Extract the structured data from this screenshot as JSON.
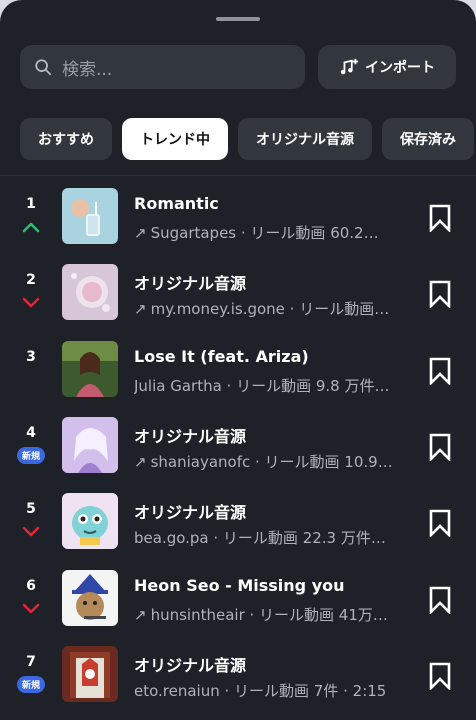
{
  "search": {
    "placeholder": "検索..."
  },
  "import_button": {
    "label": "インポート"
  },
  "tabs": [
    {
      "label": "おすすめ",
      "active": false
    },
    {
      "label": "トレンド中",
      "active": true
    },
    {
      "label": "オリジナル音源",
      "active": false
    },
    {
      "label": "保存済み",
      "active": false
    }
  ],
  "tracks": [
    {
      "rank": "1",
      "trend": "up",
      "title": "Romantic",
      "has_arrow": true,
      "subtitle": "Sugartapes · リール動画 60.2…"
    },
    {
      "rank": "2",
      "trend": "down",
      "title": "オリジナル音源",
      "has_arrow": true,
      "subtitle": "my.money.is.gone · リール動画…"
    },
    {
      "rank": "3",
      "trend": "none",
      "title": "Lose It (feat. Ariza)",
      "has_arrow": false,
      "subtitle": "Julia Gartha · リール動画 9.8 万件…"
    },
    {
      "rank": "4",
      "trend": "new",
      "badge": "新規",
      "title": "オリジナル音源",
      "has_arrow": true,
      "subtitle": "shaniayanofc · リール動画 10.9…"
    },
    {
      "rank": "5",
      "trend": "down",
      "title": "オリジナル音源",
      "has_arrow": false,
      "subtitle": "bea.go.pa · リール動画 22.3 万件…"
    },
    {
      "rank": "6",
      "trend": "down",
      "title": "Heon Seo - Missing you",
      "has_arrow": true,
      "subtitle": "hunsintheair · リール動画 41万…"
    },
    {
      "rank": "7",
      "trend": "new",
      "badge": "新規",
      "title": "オリジナル音源",
      "has_arrow": false,
      "subtitle": "eto.renaiun · リール動画 7件 · 2:15"
    }
  ],
  "colors": {
    "up": "#2fbf71",
    "down": "#e5243b",
    "new_badge": "#3b67e0"
  }
}
